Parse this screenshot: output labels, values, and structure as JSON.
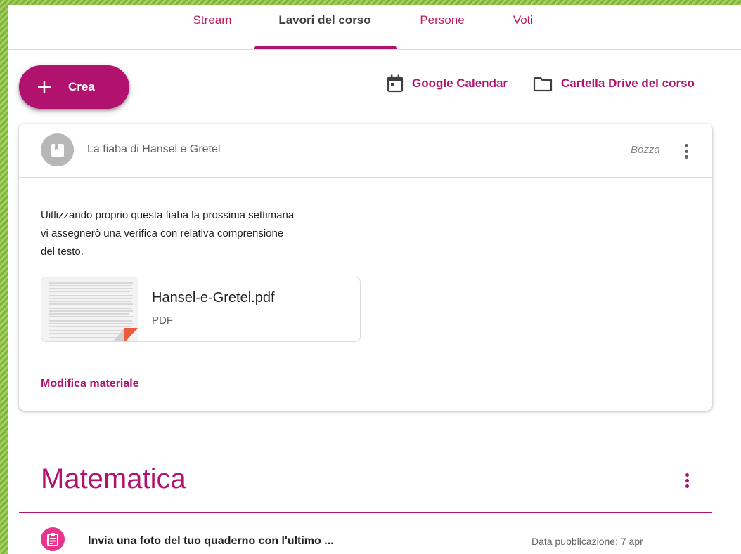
{
  "tabs": [
    {
      "label": "Stream",
      "active": false
    },
    {
      "label": "Lavori del corso",
      "active": true
    },
    {
      "label": "Persone",
      "active": false
    },
    {
      "label": "Voti",
      "active": false
    }
  ],
  "toolbar": {
    "create_label": "Crea",
    "calendar_label": "Google Calendar",
    "drive_label": "Cartella Drive del corso"
  },
  "material_card": {
    "title": "La fiaba di Hansel e Gretel",
    "status": "Bozza",
    "description_lines": [
      "Uitlizzando proprio questa fiaba la prossima settimana",
      "vi assegnerò una verifica con relativa comprensione",
      "del testo."
    ],
    "attachment": {
      "name": "Hansel-e-Gretel.pdf",
      "type": "PDF"
    },
    "edit_label": "Modifica materiale"
  },
  "section": {
    "title": "Matematica",
    "items": [
      {
        "title": "Invia una foto del tuo quaderno con l'ultimo ...",
        "date": "Data pubblicazione: 7 apr"
      }
    ]
  },
  "colors": {
    "accent": "#b0126e",
    "accent_light": "#e8348c",
    "active_tab_text": "#3c4043",
    "border": "#dadce0",
    "page_border_green": "#8bc34a"
  },
  "icons": [
    "plus-icon",
    "calendar-icon",
    "folder-icon",
    "bookmark-icon",
    "more-vert-icon",
    "assignment-icon",
    "pdf-thumbnail-icon"
  ]
}
